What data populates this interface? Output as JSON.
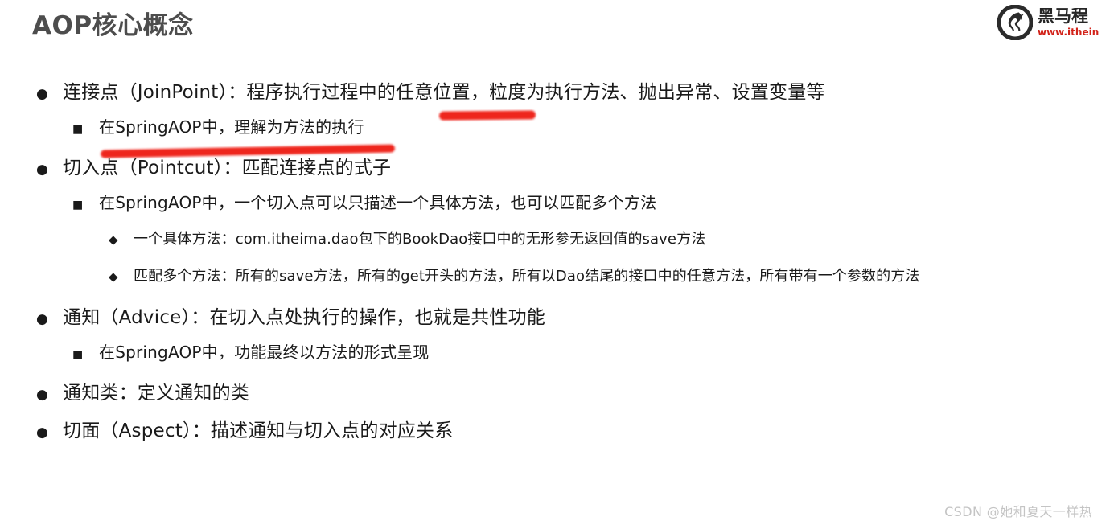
{
  "slide": {
    "title": "AOP核心概念",
    "title_color": "#4d4d4d",
    "background_color": "#ffffff"
  },
  "brand": {
    "logo_icon": "horse-head-circle-logo",
    "name": "黑马程",
    "url": "www.ithein",
    "name_color": "#262626",
    "url_color": "#d22219"
  },
  "bullets": [
    {
      "level": 1,
      "marker": "●",
      "text": "连接点（JoinPoint）：程序执行过程中的任意位置，粒度为执行方法、抛出异常、设置变量等"
    },
    {
      "level": 2,
      "marker": "■",
      "text": "在SpringAOP中，理解为方法的执行"
    },
    {
      "level": 1,
      "marker": "●",
      "text": "切入点（Pointcut）：匹配连接点的式子"
    },
    {
      "level": 2,
      "marker": "■",
      "text": "在SpringAOP中，一个切入点可以只描述一个具体方法，也可以匹配多个方法"
    },
    {
      "level": 3,
      "marker": "◆",
      "text": "一个具体方法：com.itheima.dao包下的BookDao接口中的无形参无返回值的save方法"
    },
    {
      "level": 3,
      "marker": "◆",
      "text": "匹配多个方法：所有的save方法，所有的get开头的方法，所有以Dao结尾的接口中的任意方法，所有带有一个参数的方法"
    },
    {
      "level": 1,
      "marker": "●",
      "text": "通知（Advice）：在切入点处执行的操作，也就是共性功能"
    },
    {
      "level": 2,
      "marker": "■",
      "text": "在SpringAOP中，功能最终以方法的形式呈现"
    },
    {
      "level": 1,
      "marker": "●",
      "text": "通知类：定义通知的类"
    },
    {
      "level": 1,
      "marker": "●",
      "text": "切面（Aspect）：描述通知与切入点的对应关系"
    }
  ],
  "annotations": {
    "color": "#ee1b11",
    "strokes": [
      {
        "id": "ink-1",
        "under_text": "任意位置"
      },
      {
        "id": "ink-2",
        "under_text": "在SpringAOP中，理解为方法的执行"
      }
    ]
  },
  "watermark": {
    "text": "CSDN @她和夏天一样热",
    "color": "#c4c4c4"
  }
}
